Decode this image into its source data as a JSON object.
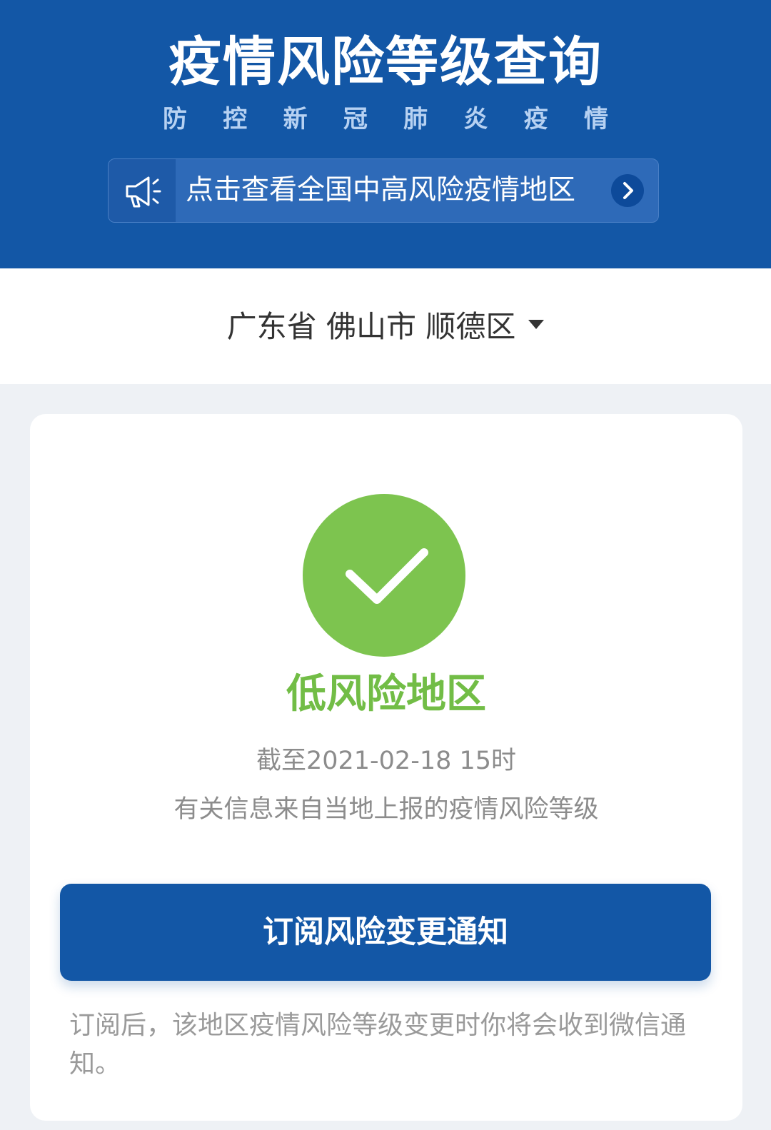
{
  "header": {
    "title": "疫情风险等级查询",
    "subtitle_chars": [
      "防",
      "控",
      "新",
      "冠",
      "肺",
      "炎",
      "疫",
      "情"
    ],
    "notice": {
      "icon": "megaphone-icon",
      "text": "点击查看全国中高风险疫情地区",
      "arrow_icon": "chevron-right-icon"
    }
  },
  "region": {
    "label": "广东省 佛山市 顺德区",
    "dropdown_icon": "caret-down-icon"
  },
  "result": {
    "status_icon": "check-circle-icon",
    "risk_level": "低风险地区",
    "as_of": "截至2021-02-18 15时",
    "source_note": "有关信息来自当地上报的疫情风险等级",
    "subscribe_button": "订阅风险变更通知",
    "subscribe_hint": "订阅后，该地区疫情风险等级变更时你将会收到微信通知。"
  },
  "colors": {
    "brand_blue": "#1357a6",
    "success_green": "#7dc44f",
    "page_background": "#eef1f5"
  }
}
